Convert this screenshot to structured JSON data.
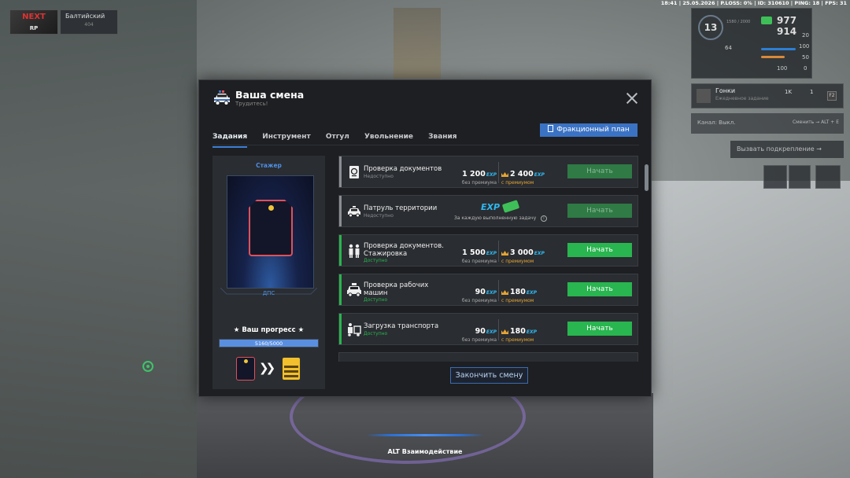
{
  "hud": {
    "status_line": "18:41 | 25.05.2026 | P.LOSS: 0% | ID: 310610 | PING: 18 | FPS: 31",
    "server_name": "Балтийский",
    "server_sub": "404",
    "logo_top": "NEXT",
    "logo_bottom": "RP",
    "level": "13",
    "level_sub": "1580 / 2000",
    "money": "977 914",
    "armor_value": "64",
    "health_value": "20",
    "food_value": "100",
    "ammo_value": "50",
    "extra_value": "0",
    "fuel_value": "100",
    "race_title": "Гонки",
    "race_sub": "Ежедневное задание",
    "race_count_1": "1K",
    "race_count_2": "1",
    "race_key": "F2",
    "channel_left": "Канал: Выкл.",
    "channel_right": "Сменить → ALT + E",
    "call_backup": "Вызвать подкрепление →"
  },
  "modal": {
    "title": "Ваша смена",
    "subtitle": "Трудитесь!",
    "tabs": [
      "Задания",
      "Инструмент",
      "Отгул",
      "Увольнение",
      "Звания"
    ],
    "active_tab": 0,
    "faction_plan_label": "Фракционный план",
    "rank": {
      "title": "Стажер",
      "name": "ДПС",
      "progress_label": "★ Ваш прогресс ★",
      "progress_text": "5160/5000",
      "progress_fraction": 1.0
    },
    "tasks": [
      {
        "name": "Проверка документов",
        "status": "Недоступно",
        "available": false,
        "icon": "passport-icon",
        "reward_normal": "1 200",
        "reward_premium": "2 400",
        "reward_normal_caption": "без премиума",
        "reward_premium_caption": "с премиумом",
        "button_label": "Начать"
      },
      {
        "name": "Патруль территории",
        "status": "Недоступно",
        "available": false,
        "icon": "patrol-car-icon",
        "reward_note": "За каждую выполненную задачу",
        "button_label": "Начать"
      },
      {
        "name": "Проверка документов. Стажировка",
        "status": "Доступно",
        "available": true,
        "icon": "officers-icon",
        "reward_normal": "1 500",
        "reward_premium": "3 000",
        "reward_normal_caption": "без премиума",
        "reward_premium_caption": "с премиумом",
        "button_label": "Начать"
      },
      {
        "name": "Проверка рабочих машин",
        "status": "Доступно",
        "available": true,
        "icon": "car-check-icon",
        "reward_normal": "90",
        "reward_premium": "180",
        "reward_normal_caption": "без премиума",
        "reward_premium_caption": "с премиумом",
        "button_label": "Начать"
      },
      {
        "name": "Загрузка транспорта",
        "status": "Доступно",
        "available": true,
        "icon": "loader-icon",
        "reward_normal": "90",
        "reward_premium": "180",
        "reward_normal_caption": "без премиума",
        "reward_premium_caption": "с премиумом",
        "button_label": "Начать"
      }
    ],
    "exp_label": "EXP",
    "end_shift_label": "Закончить смену"
  },
  "interact": {
    "label": "ALT Взаимодействие"
  },
  "colors": {
    "accent_blue": "#3b73c4",
    "available_green": "#29b54f",
    "unavailable_gray": "#8a8d92",
    "exp_blue": "#2fb8f0",
    "premium_orange": "#e5a534"
  }
}
